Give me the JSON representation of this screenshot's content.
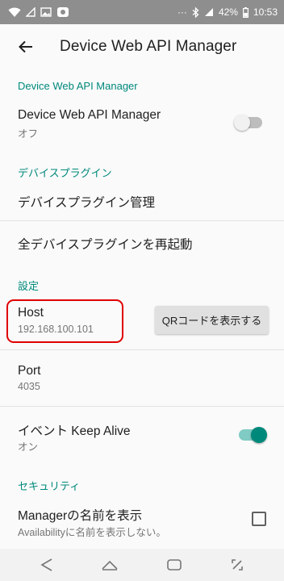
{
  "status_bar": {
    "left_icons": [
      "wifi-icon",
      "signal-icon",
      "image-icon",
      "link-icon"
    ],
    "dots": "···",
    "battery": "42%",
    "time": "10:53",
    "right_icons": [
      "bluetooth-icon",
      "signal-icon",
      "battery-icon"
    ]
  },
  "app_bar": {
    "title": "Device Web API Manager",
    "back_icon": "arrow-back-icon"
  },
  "sections": {
    "manager_header": "Device Web API Manager",
    "plugins_header": "デバイスプラグイン",
    "settings_header": "設定",
    "security_header": "セキュリティ"
  },
  "prefs": {
    "manager": {
      "title": "Device Web API Manager",
      "summary": "オフ",
      "switch_on": false
    },
    "plugin_manage": {
      "title": "デバイスプラグイン管理"
    },
    "restart_all": {
      "title": "全デバイスプラグインを再起動"
    },
    "host": {
      "title": "Host",
      "summary": "192.168.100.101",
      "button": "QRコードを表示する"
    },
    "port": {
      "title": "Port",
      "summary": "4035"
    },
    "keep_alive": {
      "title": "イベント Keep Alive",
      "summary": "オン",
      "switch_on": true
    },
    "show_name": {
      "title": "Managerの名前を表示",
      "summary": "Availabilityに名前を表示しない。",
      "checked": false
    }
  },
  "colors": {
    "accent": "#00897b",
    "highlight": "#e00000",
    "status_bar": "#8e8e8e"
  },
  "nav_bar": [
    "back-triangle-icon",
    "home-icon",
    "recents-icon",
    "screenshot-icon"
  ]
}
